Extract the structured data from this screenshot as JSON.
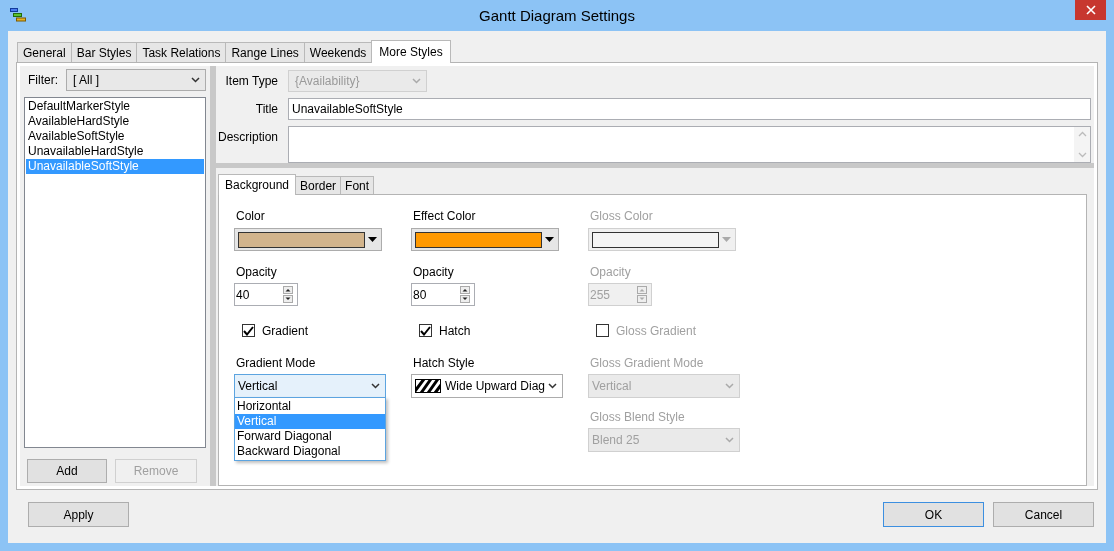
{
  "window": {
    "title": "Gantt Diagram Settings"
  },
  "tabs": [
    {
      "label": "General",
      "selected": false
    },
    {
      "label": "Bar Styles",
      "selected": false
    },
    {
      "label": "Task Relations",
      "selected": false
    },
    {
      "label": "Range Lines",
      "selected": false
    },
    {
      "label": "Weekends",
      "selected": false
    },
    {
      "label": "More Styles",
      "selected": true
    }
  ],
  "filter": {
    "label": "Filter:",
    "value": "[ All ]"
  },
  "styles_list": [
    {
      "label": "DefaultMarkerStyle",
      "selected": false
    },
    {
      "label": "AvailableHardStyle",
      "selected": false
    },
    {
      "label": "AvailableSoftStyle",
      "selected": false
    },
    {
      "label": "UnavailableHardStyle",
      "selected": false
    },
    {
      "label": "UnavailableSoftStyle",
      "selected": true
    }
  ],
  "list_buttons": [
    {
      "label": "Add",
      "disabled": false
    },
    {
      "label": "Remove",
      "disabled": true
    }
  ],
  "item_type": {
    "label": "Item Type",
    "value": "{Availability}",
    "disabled": true
  },
  "title_field": {
    "label": "Title",
    "value": "UnavailableSoftStyle"
  },
  "description": {
    "label": "Description"
  },
  "subtabs": [
    {
      "label": "Background",
      "selected": true
    },
    {
      "label": "Border",
      "selected": false
    },
    {
      "label": "Font",
      "selected": false
    }
  ],
  "columns": [
    {
      "disabled": false,
      "color_label": "Color",
      "color": "#d2b48c",
      "opacity_label": "Opacity",
      "opacity": "40",
      "check": {
        "label": "Gradient",
        "checked": true
      },
      "selects": [
        {
          "kind": "plain",
          "label": "Gradient Mode",
          "value": "Vertical",
          "focused": true,
          "options": [
            {
              "label": "Horizontal",
              "selected": false
            },
            {
              "label": "Vertical",
              "selected": true
            },
            {
              "label": "Forward Diagonal",
              "selected": false
            },
            {
              "label": "Backward Diagonal",
              "selected": false
            }
          ]
        }
      ]
    },
    {
      "disabled": false,
      "color_label": "Effect Color",
      "color": "#ff9900",
      "opacity_label": "Opacity",
      "opacity": "80",
      "check": {
        "label": "Hatch",
        "checked": true
      },
      "selects": [
        {
          "kind": "hatch",
          "label": "Hatch Style",
          "value": "Wide  Upward  Diag",
          "focused": false
        }
      ]
    },
    {
      "disabled": true,
      "color_label": "Gloss Color",
      "color": "#f4f4f4",
      "opacity_label": "Opacity",
      "opacity": "255",
      "check": {
        "label": "Gloss Gradient",
        "checked": false
      },
      "selects": [
        {
          "kind": "plain",
          "label": "Gloss Gradient Mode",
          "value": "Vertical",
          "focused": false
        },
        {
          "kind": "plain",
          "label": "Gloss Blend Style",
          "value": "Blend 25",
          "focused": false
        }
      ]
    }
  ],
  "footer_buttons": [
    {
      "label": "Apply",
      "default": false
    },
    {
      "label": "OK",
      "default": true
    },
    {
      "label": "Cancel",
      "default": false
    }
  ]
}
